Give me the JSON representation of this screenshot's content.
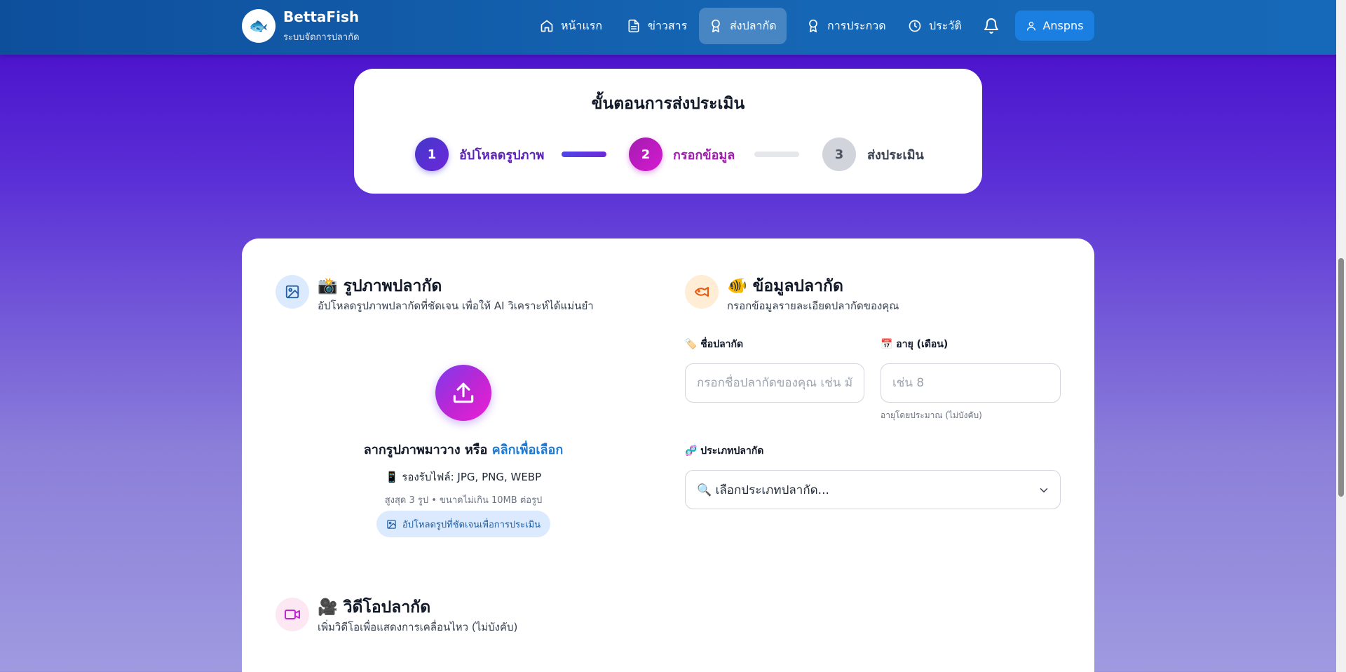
{
  "brand": {
    "name": "BettaFish",
    "subtitle": "ระบบจัดการปลากัด",
    "logo_emoji": "🐟"
  },
  "nav": {
    "items": [
      {
        "label": "หน้าแรก",
        "icon": "home-icon"
      },
      {
        "label": "ข่าวสาร",
        "icon": "document-icon"
      },
      {
        "label": "ส่งปลากัด",
        "icon": "award-icon",
        "active": true
      },
      {
        "label": "การประกวด",
        "icon": "award-icon"
      },
      {
        "label": "ประวัติ",
        "icon": "clock-icon"
      }
    ],
    "bell_icon": "bell-icon",
    "user_label": "Anspns"
  },
  "steps": {
    "title": "ขั้นตอนการส่งประเมิน",
    "items": [
      {
        "number": "1",
        "label": "อัปโหลดรูปภาพ",
        "color": "#4f46e5"
      },
      {
        "number": "2",
        "label": "กรอกข้อมูล",
        "color": "#c026d3"
      },
      {
        "number": "3",
        "label": "ส่งประเมิน",
        "color": "#d1d5db"
      }
    ]
  },
  "image_section": {
    "title": "📸 รูปภาพปลากัด",
    "subtitle": "อัปโหลดรูปภาพปลากัดที่ชัดเจน เพื่อให้ AI วิเคราะห์ได้แม่นยำ",
    "drop_text": "ลากรูปภาพมาวาง หรือ ",
    "drop_link": "คลิกเพื่อเลือก",
    "formats": "📱 รองรับไฟล์: JPG, PNG, WEBP",
    "limit": "สูงสุด 3 รูป • ขนาดไม่เกิน 10MB ต่อรูป",
    "pill": "อัปโหลดรูปที่ชัดเจนเพื่อการประเมิน"
  },
  "info_section": {
    "title": "🐠 ข้อมูลปลากัด",
    "subtitle": "กรอกข้อมูลรายละเอียดปลากัดของคุณ",
    "name_label": "🏷️ ชื่อปลากัด",
    "name_placeholder": "กรอกชื่อปลากัดของคุณ เช่น มังกรแดง",
    "age_label": "📅 อายุ (เดือน)",
    "age_placeholder": "เช่น 8",
    "age_hint": "อายุโดยประมาณ (ไม่บังคับ)",
    "type_label": "🧬 ประเภทปลากัด",
    "type_placeholder": "🔍 เลือกประเภทปลากัด..."
  },
  "video_section": {
    "title": "🎥 วิดีโอปลากัด",
    "subtitle": "เพิ่มวิดีโอเพื่อแสดงการเคลื่อนไหว (ไม่บังคับ)"
  },
  "colors": {
    "nav_bg": "#1565b3",
    "primary": "#4f46e5",
    "accent": "#c026d3",
    "link": "#1d7ad4"
  }
}
